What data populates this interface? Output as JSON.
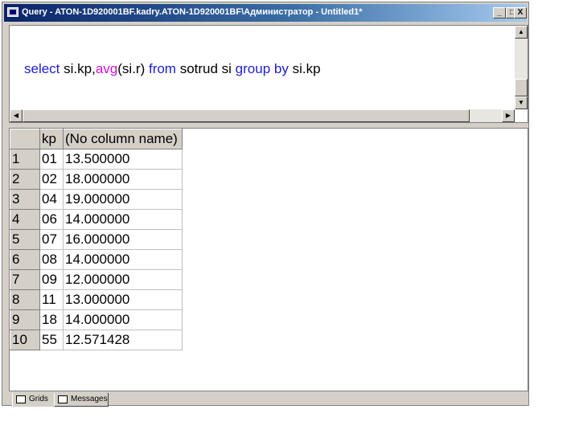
{
  "window": {
    "title": "Query - ATON-1D920001BF.kadry.ATON-1D920001BF\\Администратор - Untitled1*",
    "buttons": {
      "minimize": "_",
      "maximize": "□",
      "close": "X"
    }
  },
  "editor": {
    "query_parts": [
      {
        "text": "select",
        "style": "kw"
      },
      {
        "text": " si.kp,",
        "style": "plain"
      },
      {
        "text": "avg",
        "style": "fn"
      },
      {
        "text": "(si.r) ",
        "style": "plain"
      },
      {
        "text": "from",
        "style": "kw"
      },
      {
        "text": " sotrud si ",
        "style": "plain"
      },
      {
        "text": "group by",
        "style": "kw"
      },
      {
        "text": " si.kp",
        "style": "plain"
      }
    ]
  },
  "results": {
    "columns": [
      "kp",
      "(No column name)"
    ],
    "rows": [
      {
        "num": "1",
        "kp": "01",
        "value": "13.500000"
      },
      {
        "num": "2",
        "kp": "02",
        "value": "18.000000"
      },
      {
        "num": "3",
        "kp": "04",
        "value": "19.000000"
      },
      {
        "num": "4",
        "kp": "06",
        "value": "14.000000"
      },
      {
        "num": "5",
        "kp": "07",
        "value": "16.000000"
      },
      {
        "num": "6",
        "kp": "08",
        "value": "14.000000"
      },
      {
        "num": "7",
        "kp": "09",
        "value": "12.000000"
      },
      {
        "num": "8",
        "kp": "11",
        "value": "13.000000"
      },
      {
        "num": "9",
        "kp": "18",
        "value": "14.000000"
      },
      {
        "num": "10",
        "kp": "55",
        "value": "12.571428"
      }
    ]
  },
  "tabs": {
    "grids": "Grids",
    "messages": "Messages"
  },
  "colors": {
    "keyword": "#1c1cd0",
    "function": "#d010d0",
    "titlebar": "#0a246a"
  }
}
